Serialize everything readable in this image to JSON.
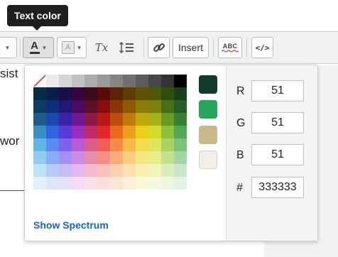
{
  "tooltip": {
    "text": "Text color"
  },
  "editor": {
    "line1_fragment": "sist",
    "line2_fragment": "wor"
  },
  "toolbar": {
    "insert_label": "Insert",
    "spellcheck_label": "ABC",
    "clear_format_glyph": "Tx",
    "text_color_glyph": "A",
    "highlight_glyph": "A",
    "code_view_glyph": "</>"
  },
  "color_picker": {
    "show_spectrum_label": "Show Spectrum",
    "recent_colors": [
      "#0e3b2e",
      "#26a65b",
      "#c8b88a",
      "#f2efe6"
    ],
    "grays": [
      "#ffffff",
      "#ebebeb",
      "#d6d6d6",
      "#c2c2c2",
      "#adadad",
      "#999999",
      "#858585",
      "#707070",
      "#5c5c5c",
      "#474747",
      "#333333",
      "#000000"
    ],
    "hue_columns": [
      [
        "#0a2a45",
        "#0b3a64",
        "#1b5e8a",
        "#3a8fc8",
        "#60b4e6",
        "#8fcdf0",
        "#bfe3f6",
        "#dff1fb"
      ],
      [
        "#0a1e4e",
        "#0f2f7a",
        "#1b47b2",
        "#2f66e0",
        "#5b8af0",
        "#8aabf5",
        "#b7cbf9",
        "#dde7fc"
      ],
      [
        "#1a0e4a",
        "#251776",
        "#3a23a8",
        "#5a39d6",
        "#7e62ea",
        "#a38ef1",
        "#c8bcf7",
        "#e6e0fb"
      ],
      [
        "#30073f",
        "#4a0c63",
        "#6e178f",
        "#9a2cbe",
        "#b95ad6",
        "#cf8ae4",
        "#e2b8ef",
        "#f2ddf7"
      ],
      [
        "#3a0a1a",
        "#5c0f2a",
        "#8a1a44",
        "#c02a66",
        "#dc5c8c",
        "#e98daf",
        "#f3bccf",
        "#f9dfe8"
      ],
      [
        "#5a0a0a",
        "#850f0f",
        "#b81818",
        "#e02a2a",
        "#ee5f55",
        "#f48f86",
        "#f9bfb8",
        "#fcdedb"
      ],
      [
        "#5c2406",
        "#8a3608",
        "#bd4d0c",
        "#e8691a",
        "#f38a48",
        "#f7ac7c",
        "#fbcfb0",
        "#fde6d6"
      ],
      [
        "#5e3c04",
        "#8d5a06",
        "#c07c0a",
        "#eba018",
        "#f5ba4a",
        "#f8cd7e",
        "#fbe0b0",
        "#fdf0d8"
      ],
      [
        "#5e5204",
        "#8c7b06",
        "#bfa80a",
        "#e9cf18",
        "#f1dd4c",
        "#f5e67e",
        "#f9efb0",
        "#fcf7d8"
      ],
      [
        "#52560a",
        "#7c800e",
        "#aab017",
        "#d3da2a",
        "#e0e65c",
        "#e8ec8a",
        "#f1f4b8",
        "#f8f9dc"
      ],
      [
        "#2f4d10",
        "#476f18",
        "#679a24",
        "#8cc23a",
        "#a8d466",
        "#c2e18f",
        "#dbedbc",
        "#edf6de"
      ],
      [
        "#1a3d1a",
        "#275c27",
        "#388038",
        "#52a852",
        "#7bc27b",
        "#a2d6a2",
        "#c9e8c9",
        "#e4f3e4"
      ]
    ],
    "r_label": "R",
    "g_label": "G",
    "b_label": "B",
    "hex_label": "#",
    "r_value": "51",
    "g_value": "51",
    "b_value": "51",
    "hex_value": "333333"
  }
}
